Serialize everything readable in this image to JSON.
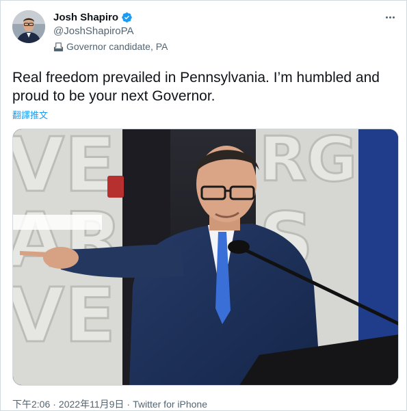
{
  "author": {
    "display_name": "Josh Shapiro",
    "handle": "@JoshShapiroPA",
    "label": "Governor candidate, PA",
    "verified": true,
    "icons": {
      "verified": "verified-badge-icon",
      "label": "ballot-box-icon",
      "avatar": "avatar"
    }
  },
  "tweet": {
    "text": "Real freedom prevailed in Pennsylvania. I’m humbled and proud to be your next Governor.",
    "translate_link": "翻譯推文",
    "media": {
      "type": "photo",
      "alt": ""
    }
  },
  "meta": {
    "time": "下午2:06",
    "separator": "·",
    "date": "2022年11月9日",
    "source": "Twitter for iPhone"
  },
  "menu": {
    "icon": "more-options-icon"
  },
  "colors": {
    "accent": "#1d9bf0",
    "secondary_text": "#536471",
    "primary_text": "#0f1419"
  }
}
